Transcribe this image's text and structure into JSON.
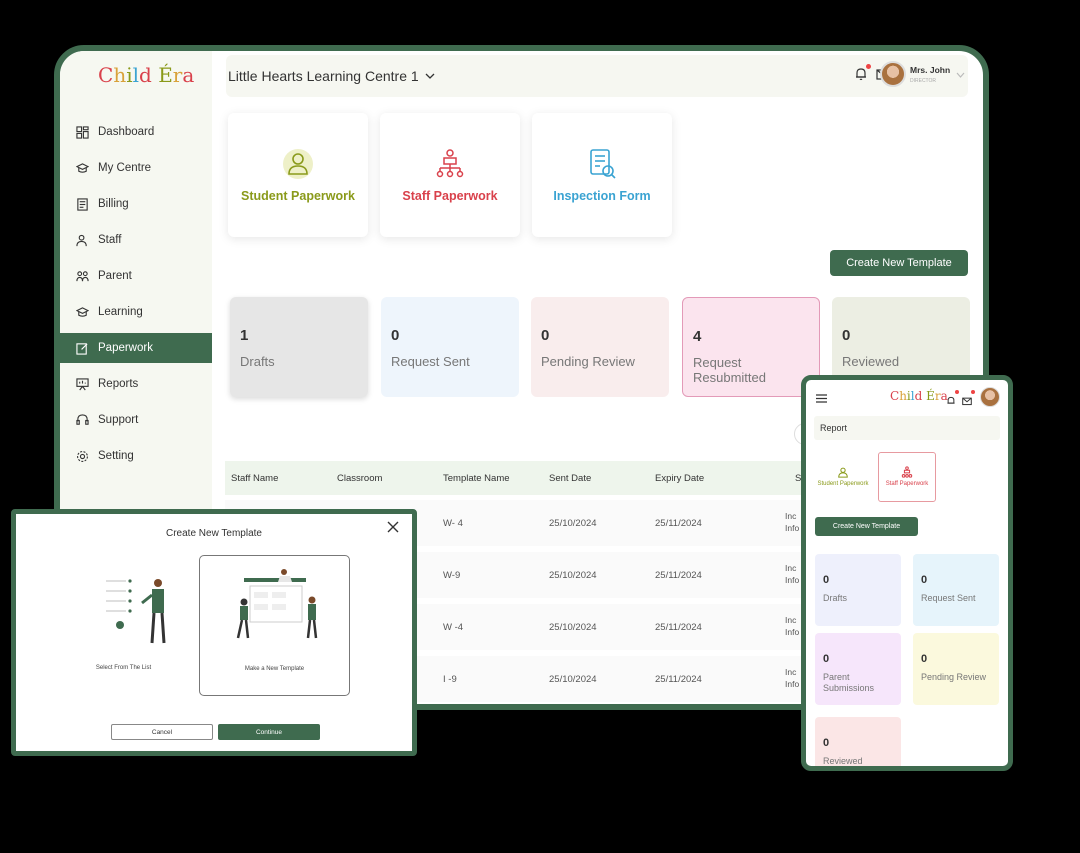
{
  "logo": {
    "text": "Child Era"
  },
  "sidebar": {
    "items": [
      {
        "label": "Dashboard",
        "icon": "dashboard-icon"
      },
      {
        "label": "My Centre",
        "icon": "centre-icon"
      },
      {
        "label": "Billing",
        "icon": "billing-icon"
      },
      {
        "label": "Staff",
        "icon": "staff-icon"
      },
      {
        "label": "Parent",
        "icon": "parent-icon"
      },
      {
        "label": "Learning",
        "icon": "learning-icon"
      },
      {
        "label": "Paperwork",
        "icon": "paperwork-icon",
        "active": true
      },
      {
        "label": "Reports",
        "icon": "reports-icon"
      },
      {
        "label": "Support",
        "icon": "support-icon"
      },
      {
        "label": "Setting",
        "icon": "setting-icon"
      }
    ]
  },
  "header": {
    "centre": "Little Hearts Learning Centre 1",
    "user_name": "Mrs. John",
    "user_role": "DIRECTOR"
  },
  "paperwork_cards": [
    {
      "label": "Student Paperwork",
      "color": "#8a9a1a"
    },
    {
      "label": "Staff Paperwork",
      "color": "#d9414b"
    },
    {
      "label": "Inspection Form",
      "color": "#3aa3d2"
    }
  ],
  "create_template_label": "Create New Template",
  "stats": [
    {
      "count": "1",
      "label": "Drafts",
      "bg": "#e6e6e6"
    },
    {
      "count": "0",
      "label": "Request Sent",
      "bg": "#eef5fc"
    },
    {
      "count": "0",
      "label": "Pending Review",
      "bg": "#f9eded"
    },
    {
      "count": "4",
      "label": "Request Resubmitted",
      "bg": "#fbe4ee"
    },
    {
      "count": "0",
      "label": "Reviewed",
      "bg": "#eceee3"
    }
  ],
  "table": {
    "headers": [
      "Staff Name",
      "Classroom",
      "Template Name",
      "Sent Date",
      "Expiry Date",
      "S"
    ],
    "rows": [
      {
        "template": "W- 4",
        "sent": "25/10/2024",
        "expiry": "25/11/2024",
        "status1": "Inc",
        "status2": "Info"
      },
      {
        "template": "W-9",
        "sent": "25/10/2024",
        "expiry": "25/11/2024",
        "status1": "Inc",
        "status2": "Info"
      },
      {
        "template": "W -4",
        "sent": "25/10/2024",
        "expiry": "25/11/2024",
        "status1": "Inc",
        "status2": "Info"
      },
      {
        "template": "I -9",
        "sent": "25/10/2024",
        "expiry": "25/11/2024",
        "status1": "Inc",
        "status2": "Info"
      }
    ]
  },
  "modal": {
    "title": "Create New Template",
    "option1": "Select From The List",
    "option2": "Make a New Template",
    "cancel": "Cancel",
    "continue": "Continue"
  },
  "mobile": {
    "section": "Report",
    "card1": "Student Paperwork",
    "card2": "Staff Paperwork",
    "create": "Create New Template",
    "stats": [
      {
        "count": "0",
        "label": "Drafts",
        "bg": "#eef0fc"
      },
      {
        "count": "0",
        "label": "Request Sent",
        "bg": "#e6f4fb"
      },
      {
        "count": "0",
        "label": "Parent Submissions",
        "bg": "#f6e6fb"
      },
      {
        "count": "0",
        "label": "Pending Review",
        "bg": "#fbf9dd"
      },
      {
        "count": "0",
        "label": "Reviewed",
        "bg": "#fbe6e6"
      }
    ]
  },
  "colors": {
    "accent": "#3f6b4f"
  }
}
